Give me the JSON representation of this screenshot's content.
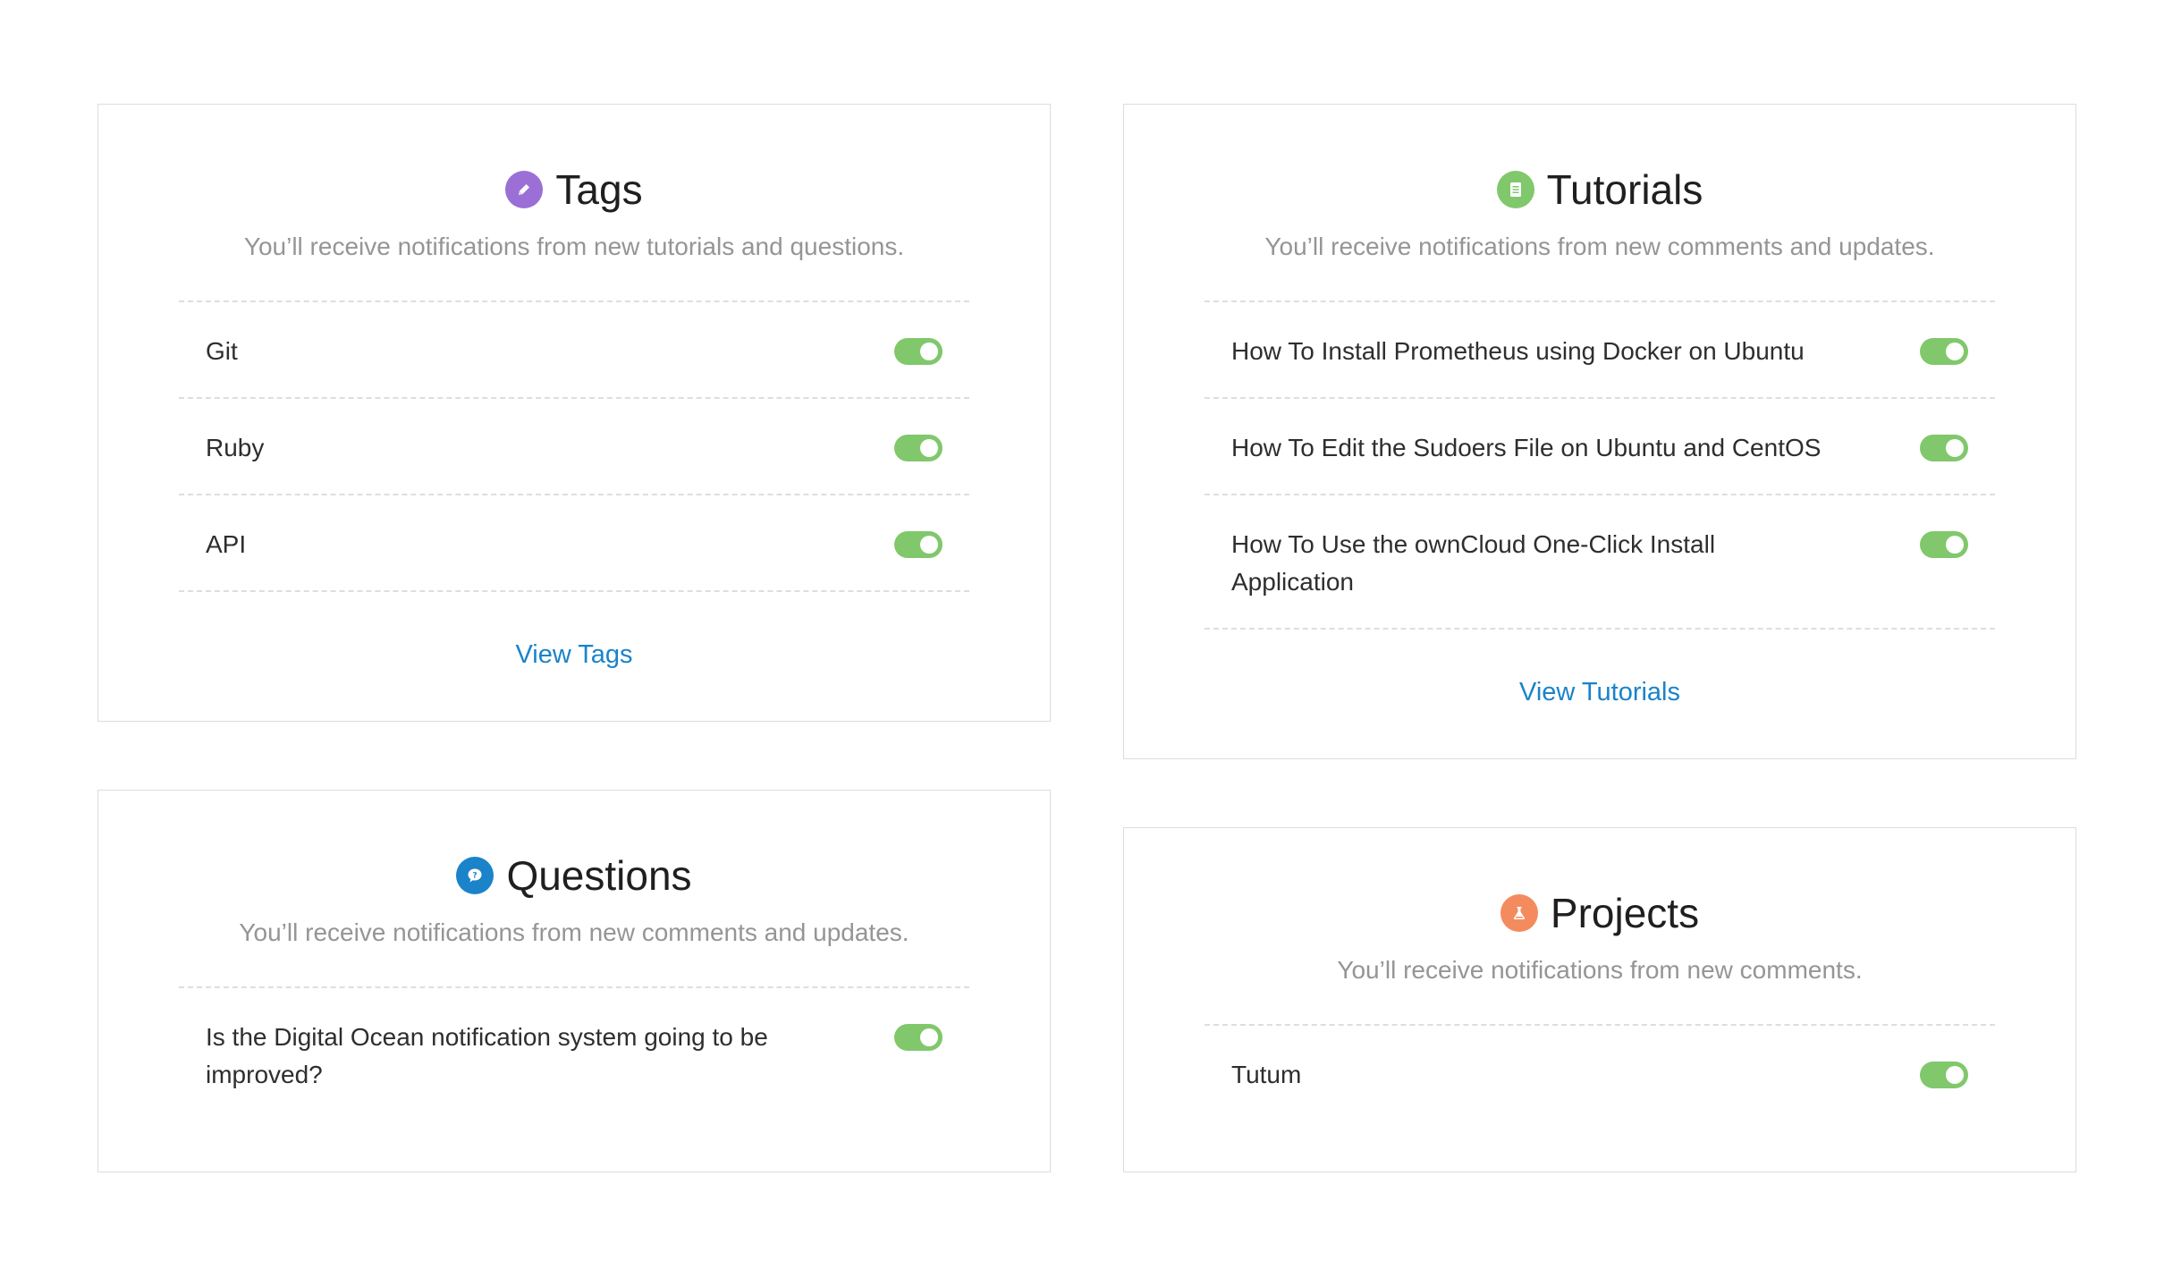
{
  "cards": {
    "tags": {
      "title": "Tags",
      "subtitle": "You’ll receive notifications from new tutorials and questions.",
      "icon": "pencil-icon",
      "icon_color": "#9b6fd6",
      "items": [
        {
          "label": "Git",
          "enabled": true
        },
        {
          "label": "Ruby",
          "enabled": true
        },
        {
          "label": "API",
          "enabled": true
        }
      ],
      "link_label": "View Tags"
    },
    "tutorials": {
      "title": "Tutorials",
      "subtitle": "You’ll receive notifications from new comments and updates.",
      "icon": "document-icon",
      "icon_color": "#80c86b",
      "items": [
        {
          "label": "How To Install Prometheus using Docker on Ubuntu",
          "enabled": true
        },
        {
          "label": "How To Edit the Sudoers File on Ubuntu and CentOS",
          "enabled": true
        },
        {
          "label": "How To Use the ownCloud One-Click Install Application",
          "enabled": true
        }
      ],
      "link_label": "View Tutorials"
    },
    "questions": {
      "title": "Questions",
      "subtitle": "You’ll receive notifications from new comments and updates.",
      "icon": "question-icon",
      "icon_color": "#1a83c9",
      "items": [
        {
          "label": "Is the Digital Ocean notification system going to be improved?",
          "enabled": true
        }
      ]
    },
    "projects": {
      "title": "Projects",
      "subtitle": "You’ll receive notifications from new comments.",
      "icon": "flask-icon",
      "icon_color": "#f48b5f",
      "items": [
        {
          "label": "Tutum",
          "enabled": true
        }
      ]
    }
  },
  "colors": {
    "toggle_on": "#80c86b",
    "link": "#1a83c9",
    "subtitle": "#959595",
    "divider": "#dedede"
  }
}
